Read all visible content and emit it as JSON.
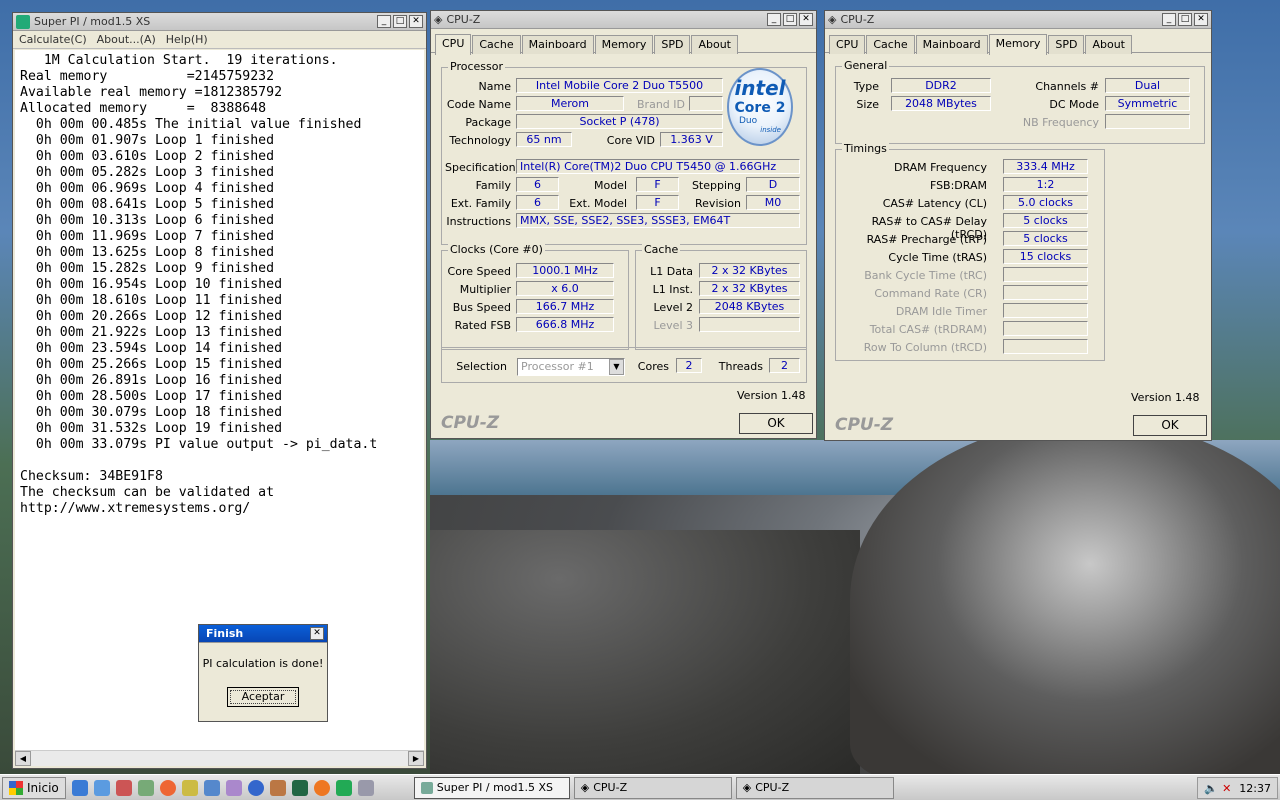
{
  "superpi": {
    "title": "Super PI / mod1.5 XS",
    "menu": [
      "Calculate(C)",
      "About...(A)",
      "Help(H)"
    ],
    "console": [
      "   1M Calculation Start.  19 iterations.",
      "Real memory          =2145759232",
      "Available real memory =1812385792",
      "Allocated memory     =  8388648",
      "  0h 00m 00.485s The initial value finished",
      "  0h 00m 01.907s Loop 1 finished",
      "  0h 00m 03.610s Loop 2 finished",
      "  0h 00m 05.282s Loop 3 finished",
      "  0h 00m 06.969s Loop 4 finished",
      "  0h 00m 08.641s Loop 5 finished",
      "  0h 00m 10.313s Loop 6 finished",
      "  0h 00m 11.969s Loop 7 finished",
      "  0h 00m 13.625s Loop 8 finished",
      "  0h 00m 15.282s Loop 9 finished",
      "  0h 00m 16.954s Loop 10 finished",
      "  0h 00m 18.610s Loop 11 finished",
      "  0h 00m 20.266s Loop 12 finished",
      "  0h 00m 21.922s Loop 13 finished",
      "  0h 00m 23.594s Loop 14 finished",
      "  0h 00m 25.266s Loop 15 finished",
      "  0h 00m 26.891s Loop 16 finished",
      "  0h 00m 28.500s Loop 17 finished",
      "  0h 00m 30.079s Loop 18 finished",
      "  0h 00m 31.532s Loop 19 finished",
      "  0h 00m 33.079s PI value output -> pi_data.t",
      "",
      "Checksum: 34BE91F8",
      "The checksum can be validated at",
      "http://www.xtremesystems.org/"
    ]
  },
  "finish": {
    "title": "Finish",
    "message": "PI calculation is done!",
    "button": "Aceptar"
  },
  "cpuz1": {
    "title": "CPU-Z",
    "tabs": [
      "CPU",
      "Cache",
      "Mainboard",
      "Memory",
      "SPD",
      "About"
    ],
    "processor_label": "Processor",
    "name_l": "Name",
    "name": "Intel Mobile Core 2 Duo T5500",
    "codename_l": "Code Name",
    "codename": "Merom",
    "brandid_l": "Brand ID",
    "brandid": "",
    "package_l": "Package",
    "package": "Socket P (478)",
    "tech_l": "Technology",
    "tech": "65 nm",
    "vid_l": "Core VID",
    "vid": "1.363 V",
    "spec_l": "Specification",
    "spec": "Intel(R) Core(TM)2 Duo CPU     T5450  @ 1.66GHz",
    "family_l": "Family",
    "family": "6",
    "model_l": "Model",
    "model": "F",
    "stepping_l": "Stepping",
    "stepping": "D",
    "extfam_l": "Ext. Family",
    "extfam": "6",
    "extmod_l": "Ext. Model",
    "extmod": "F",
    "rev_l": "Revision",
    "rev": "M0",
    "instr_l": "Instructions",
    "instr": "MMX, SSE, SSE2, SSE3, SSSE3, EM64T",
    "clocks_label": "Clocks (Core #0)",
    "cs_l": "Core Speed",
    "cs": "1000.1 MHz",
    "mult_l": "Multiplier",
    "mult": "x 6.0",
    "bus_l": "Bus Speed",
    "bus": "166.7 MHz",
    "fsb_l": "Rated FSB",
    "fsb": "666.8 MHz",
    "cache_label": "Cache",
    "l1d_l": "L1 Data",
    "l1d": "2 x 32 KBytes",
    "l1i_l": "L1 Inst.",
    "l1i": "2 x 32 KBytes",
    "l2_l": "Level 2",
    "l2": "2048 KBytes",
    "l3_l": "Level 3",
    "l3": "",
    "sel_l": "Selection",
    "sel": "Processor #1",
    "cores_l": "Cores",
    "cores": "2",
    "threads_l": "Threads",
    "threads": "2",
    "version": "Version 1.48",
    "brand": "CPU-Z",
    "ok": "OK",
    "intel_logo": {
      "a": "intel",
      "b": "Core 2",
      "c": "Duo",
      "d": "inside"
    }
  },
  "cpuz2": {
    "title": "CPU-Z",
    "tabs": [
      "CPU",
      "Cache",
      "Mainboard",
      "Memory",
      "SPD",
      "About"
    ],
    "general_label": "General",
    "type_l": "Type",
    "type": "DDR2",
    "size_l": "Size",
    "size": "2048 MBytes",
    "ch_l": "Channels #",
    "ch": "Dual",
    "dc_l": "DC Mode",
    "dc": "Symmetric",
    "nb_l": "NB Frequency",
    "nb": "",
    "timings_label": "Timings",
    "t": [
      {
        "l": "DRAM Frequency",
        "v": "333.4 MHz",
        "dis": false
      },
      {
        "l": "FSB:DRAM",
        "v": "1:2",
        "dis": false
      },
      {
        "l": "CAS# Latency (CL)",
        "v": "5.0 clocks",
        "dis": false
      },
      {
        "l": "RAS# to CAS# Delay (tRCD)",
        "v": "5 clocks",
        "dis": false
      },
      {
        "l": "RAS# Precharge (tRP)",
        "v": "5 clocks",
        "dis": false
      },
      {
        "l": "Cycle Time (tRAS)",
        "v": "15 clocks",
        "dis": false
      },
      {
        "l": "Bank Cycle Time (tRC)",
        "v": "",
        "dis": true
      },
      {
        "l": "Command Rate (CR)",
        "v": "",
        "dis": true
      },
      {
        "l": "DRAM Idle Timer",
        "v": "",
        "dis": true
      },
      {
        "l": "Total CAS# (tRDRAM)",
        "v": "",
        "dis": true
      },
      {
        "l": "Row To Column (tRCD)",
        "v": "",
        "dis": true
      }
    ],
    "version": "Version 1.48",
    "brand": "CPU-Z",
    "ok": "OK"
  },
  "taskbar": {
    "start": "Inicio",
    "tasks": [
      "Super PI / mod1.5 XS",
      "CPU-Z",
      "CPU-Z"
    ],
    "clock": "12:37"
  }
}
